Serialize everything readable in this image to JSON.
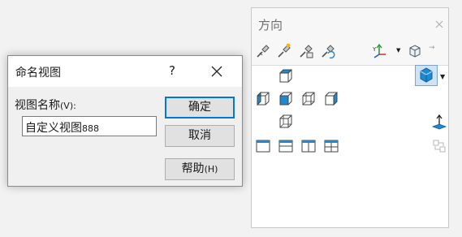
{
  "name_view_dialog": {
    "title": "命名视图",
    "help_glyph": "?",
    "field_label": "视图名称",
    "field_label_hotkey": "(V):",
    "name_value_text": "自定义视图",
    "name_value_num": "888",
    "ok_label": "确定",
    "cancel_label": "取消",
    "help_label": "帮助",
    "help_hotkey": "(H)",
    "ok_border_color": "#0078d7"
  },
  "orientation_panel": {
    "title": "方向",
    "close_glyph": "×",
    "more_glyph": "→",
    "viewcube_dropdown_glyph": "▼",
    "toolbar_icons": [
      "pin-view-icon",
      "new-view-icon",
      "update-standard-views-icon",
      "reset-standard-views-icon",
      "view-selector-icon",
      "view-options-icon"
    ],
    "view_icons": [
      "top-view-icon",
      "left-view-icon",
      "front-view-icon",
      "right-view-icon",
      "back-view-icon",
      "bottom-view-icon",
      "single-view-icon",
      "two-view-horizontal-icon",
      "two-view-vertical-icon",
      "four-view-icon"
    ],
    "accent_color": "#1e88d2"
  }
}
